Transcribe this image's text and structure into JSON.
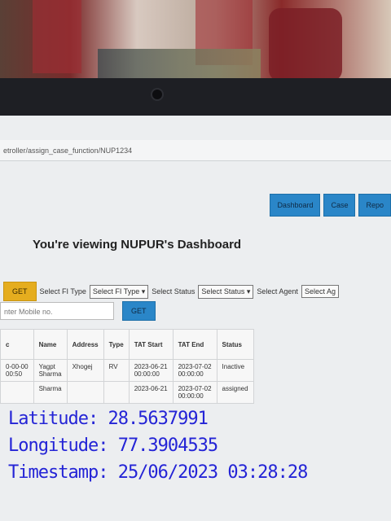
{
  "browser": {
    "url": "etroller/assign_case_function/NUP1234"
  },
  "nav": {
    "buttons": [
      "Dashboard",
      "Case",
      "Repo"
    ]
  },
  "page_title": "You're viewing NUPUR's Dashboard",
  "filters": {
    "get_label": "GET",
    "fi_type_label": "Select FI Type",
    "fi_type_value": "Select FI Type",
    "status_label": "Select Status",
    "status_value": "Select Status",
    "agent_label": "Select Agent",
    "agent_value": "Select Ag"
  },
  "mobile": {
    "placeholder": "nter Mobile no.",
    "get_label": "GET"
  },
  "table": {
    "headers": [
      "c",
      "Name",
      "Address",
      "Type",
      "TAT Start",
      "TAT End",
      "Status"
    ],
    "rows": [
      [
        "0-00-00\n00:50",
        "Yagpt\nSharma",
        "Xhogej",
        "RV",
        "2023-06-21\n00:00:00",
        "2023-07-02\n00:00:00",
        "Inactive"
      ],
      [
        "",
        "Sharma",
        "",
        "",
        "2023-06-21",
        "2023-07-02\n00:00:00",
        "assigned"
      ]
    ]
  },
  "overlay": {
    "latitude": "Latitude: 28.5637991",
    "longitude": "Longitude: 77.3904535",
    "timestamp": "Timestamp: 25/06/2023 03:28:28"
  }
}
